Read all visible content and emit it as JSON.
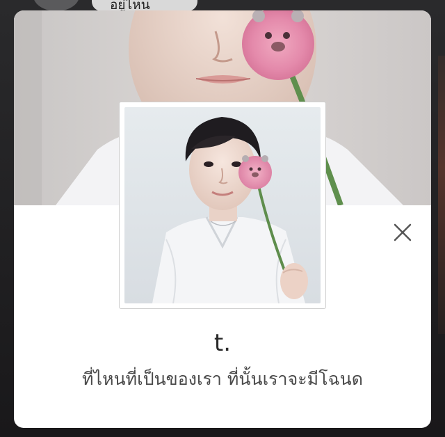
{
  "background_chat": {
    "bubble_text": "อยู่ไหน"
  },
  "profile": {
    "name": "t.",
    "status_message": "ที่ไหนที่เป็นของเรา ที่นั้นเราจะมีโฉนด"
  },
  "icons": {
    "close": "close-icon"
  },
  "colors": {
    "modal_background": "#ffffff",
    "close_icon": "#555555",
    "name_text": "#2b2b2b",
    "status_text": "#4a4a4a"
  }
}
